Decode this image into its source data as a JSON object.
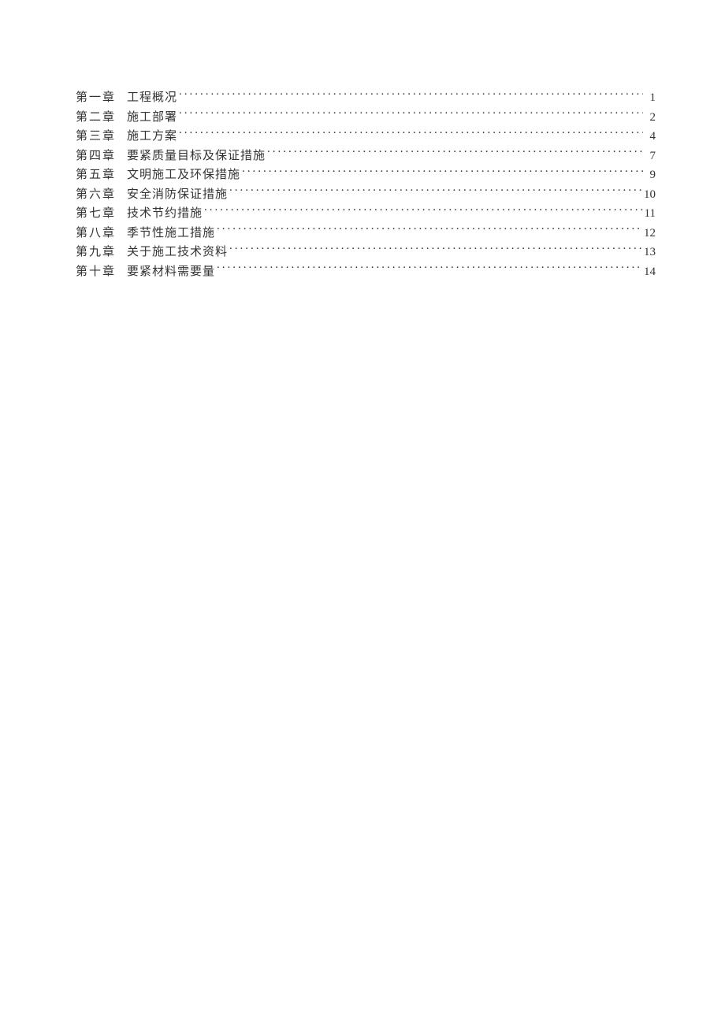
{
  "toc": {
    "entries": [
      {
        "chapter": "第一章",
        "title": "工程概况",
        "page": "1"
      },
      {
        "chapter": "第二章",
        "title": "施工部署",
        "page": "2"
      },
      {
        "chapter": "第三章",
        "title": "施工方案",
        "page": "4"
      },
      {
        "chapter": "第四章",
        "title": "要紧质量目标及保证措施",
        "page": "7"
      },
      {
        "chapter": "第五章",
        "title": "文明施工及环保措施",
        "page": "9"
      },
      {
        "chapter": "第六章",
        "title": "安全消防保证措施",
        "page": "10"
      },
      {
        "chapter": "第七章",
        "title": "技术节约措施",
        "page": "11"
      },
      {
        "chapter": "第八章",
        "title": "季节性施工措施",
        "page": "12"
      },
      {
        "chapter": "第九章",
        "title": "关于施工技术资料",
        "page": "13"
      },
      {
        "chapter": "第十章",
        "title": "要紧材料需要量",
        "page": "14"
      }
    ]
  }
}
